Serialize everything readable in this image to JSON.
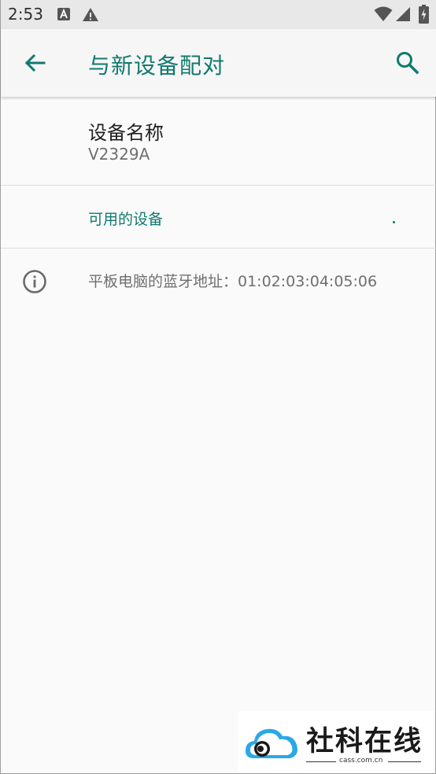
{
  "status_bar": {
    "time": "2:53",
    "left_icons": [
      "a-notification-icon",
      "warning-icon"
    ],
    "right_icons": [
      "wifi-icon",
      "signal-icon",
      "battery-charging-icon"
    ]
  },
  "app_bar": {
    "title": "与新设备配对",
    "accent_color": "#107a6f"
  },
  "device_name": {
    "title": "设备名称",
    "value": "V2329A"
  },
  "available_devices": {
    "header": "可用的设备"
  },
  "footer_info": {
    "text": "平板电脑的蓝牙地址：01:02:03:04:05:06"
  },
  "watermark": {
    "name": "社科在线",
    "domain": "cass.com.cn"
  }
}
